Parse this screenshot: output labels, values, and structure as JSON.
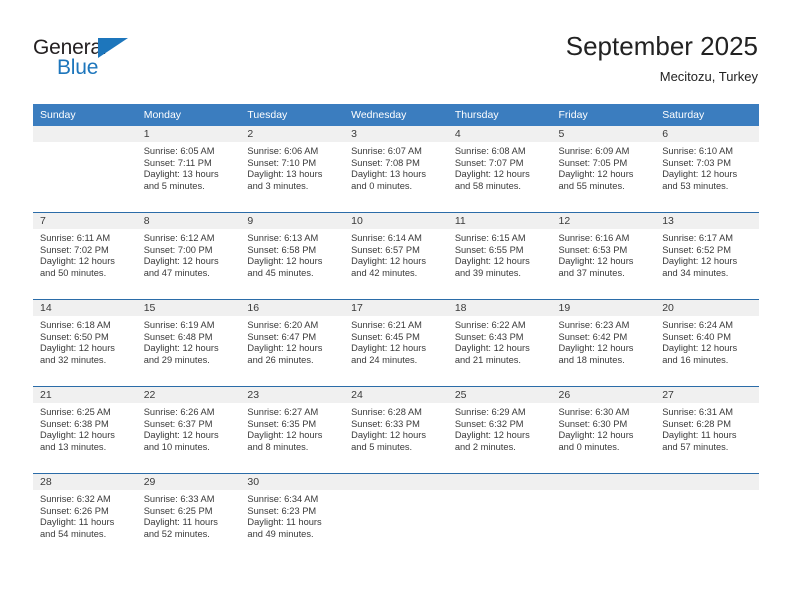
{
  "brand": {
    "name_top": "General",
    "name_bottom": "Blue",
    "color_dark": "#231f20",
    "color_blue": "#1d76bc"
  },
  "header": {
    "title": "September 2025",
    "subtitle": "Mecitozu, Turkey"
  },
  "theme": {
    "header_blue": "#3b7dbf",
    "separator_blue": "#2b6ca8",
    "daynum_band": "#f0f0f0",
    "text": "#3a3a3a"
  },
  "weekdays": [
    "Sunday",
    "Monday",
    "Tuesday",
    "Wednesday",
    "Thursday",
    "Friday",
    "Saturday"
  ],
  "weeks": [
    [
      {
        "day": "",
        "sunrise": "",
        "sunset": "",
        "daylight1": "",
        "daylight2": ""
      },
      {
        "day": "1",
        "sunrise": "Sunrise: 6:05 AM",
        "sunset": "Sunset: 7:11 PM",
        "daylight1": "Daylight: 13 hours",
        "daylight2": "and 5 minutes."
      },
      {
        "day": "2",
        "sunrise": "Sunrise: 6:06 AM",
        "sunset": "Sunset: 7:10 PM",
        "daylight1": "Daylight: 13 hours",
        "daylight2": "and 3 minutes."
      },
      {
        "day": "3",
        "sunrise": "Sunrise: 6:07 AM",
        "sunset": "Sunset: 7:08 PM",
        "daylight1": "Daylight: 13 hours",
        "daylight2": "and 0 minutes."
      },
      {
        "day": "4",
        "sunrise": "Sunrise: 6:08 AM",
        "sunset": "Sunset: 7:07 PM",
        "daylight1": "Daylight: 12 hours",
        "daylight2": "and 58 minutes."
      },
      {
        "day": "5",
        "sunrise": "Sunrise: 6:09 AM",
        "sunset": "Sunset: 7:05 PM",
        "daylight1": "Daylight: 12 hours",
        "daylight2": "and 55 minutes."
      },
      {
        "day": "6",
        "sunrise": "Sunrise: 6:10 AM",
        "sunset": "Sunset: 7:03 PM",
        "daylight1": "Daylight: 12 hours",
        "daylight2": "and 53 minutes."
      }
    ],
    [
      {
        "day": "7",
        "sunrise": "Sunrise: 6:11 AM",
        "sunset": "Sunset: 7:02 PM",
        "daylight1": "Daylight: 12 hours",
        "daylight2": "and 50 minutes."
      },
      {
        "day": "8",
        "sunrise": "Sunrise: 6:12 AM",
        "sunset": "Sunset: 7:00 PM",
        "daylight1": "Daylight: 12 hours",
        "daylight2": "and 47 minutes."
      },
      {
        "day": "9",
        "sunrise": "Sunrise: 6:13 AM",
        "sunset": "Sunset: 6:58 PM",
        "daylight1": "Daylight: 12 hours",
        "daylight2": "and 45 minutes."
      },
      {
        "day": "10",
        "sunrise": "Sunrise: 6:14 AM",
        "sunset": "Sunset: 6:57 PM",
        "daylight1": "Daylight: 12 hours",
        "daylight2": "and 42 minutes."
      },
      {
        "day": "11",
        "sunrise": "Sunrise: 6:15 AM",
        "sunset": "Sunset: 6:55 PM",
        "daylight1": "Daylight: 12 hours",
        "daylight2": "and 39 minutes."
      },
      {
        "day": "12",
        "sunrise": "Sunrise: 6:16 AM",
        "sunset": "Sunset: 6:53 PM",
        "daylight1": "Daylight: 12 hours",
        "daylight2": "and 37 minutes."
      },
      {
        "day": "13",
        "sunrise": "Sunrise: 6:17 AM",
        "sunset": "Sunset: 6:52 PM",
        "daylight1": "Daylight: 12 hours",
        "daylight2": "and 34 minutes."
      }
    ],
    [
      {
        "day": "14",
        "sunrise": "Sunrise: 6:18 AM",
        "sunset": "Sunset: 6:50 PM",
        "daylight1": "Daylight: 12 hours",
        "daylight2": "and 32 minutes."
      },
      {
        "day": "15",
        "sunrise": "Sunrise: 6:19 AM",
        "sunset": "Sunset: 6:48 PM",
        "daylight1": "Daylight: 12 hours",
        "daylight2": "and 29 minutes."
      },
      {
        "day": "16",
        "sunrise": "Sunrise: 6:20 AM",
        "sunset": "Sunset: 6:47 PM",
        "daylight1": "Daylight: 12 hours",
        "daylight2": "and 26 minutes."
      },
      {
        "day": "17",
        "sunrise": "Sunrise: 6:21 AM",
        "sunset": "Sunset: 6:45 PM",
        "daylight1": "Daylight: 12 hours",
        "daylight2": "and 24 minutes."
      },
      {
        "day": "18",
        "sunrise": "Sunrise: 6:22 AM",
        "sunset": "Sunset: 6:43 PM",
        "daylight1": "Daylight: 12 hours",
        "daylight2": "and 21 minutes."
      },
      {
        "day": "19",
        "sunrise": "Sunrise: 6:23 AM",
        "sunset": "Sunset: 6:42 PM",
        "daylight1": "Daylight: 12 hours",
        "daylight2": "and 18 minutes."
      },
      {
        "day": "20",
        "sunrise": "Sunrise: 6:24 AM",
        "sunset": "Sunset: 6:40 PM",
        "daylight1": "Daylight: 12 hours",
        "daylight2": "and 16 minutes."
      }
    ],
    [
      {
        "day": "21",
        "sunrise": "Sunrise: 6:25 AM",
        "sunset": "Sunset: 6:38 PM",
        "daylight1": "Daylight: 12 hours",
        "daylight2": "and 13 minutes."
      },
      {
        "day": "22",
        "sunrise": "Sunrise: 6:26 AM",
        "sunset": "Sunset: 6:37 PM",
        "daylight1": "Daylight: 12 hours",
        "daylight2": "and 10 minutes."
      },
      {
        "day": "23",
        "sunrise": "Sunrise: 6:27 AM",
        "sunset": "Sunset: 6:35 PM",
        "daylight1": "Daylight: 12 hours",
        "daylight2": "and 8 minutes."
      },
      {
        "day": "24",
        "sunrise": "Sunrise: 6:28 AM",
        "sunset": "Sunset: 6:33 PM",
        "daylight1": "Daylight: 12 hours",
        "daylight2": "and 5 minutes."
      },
      {
        "day": "25",
        "sunrise": "Sunrise: 6:29 AM",
        "sunset": "Sunset: 6:32 PM",
        "daylight1": "Daylight: 12 hours",
        "daylight2": "and 2 minutes."
      },
      {
        "day": "26",
        "sunrise": "Sunrise: 6:30 AM",
        "sunset": "Sunset: 6:30 PM",
        "daylight1": "Daylight: 12 hours",
        "daylight2": "and 0 minutes."
      },
      {
        "day": "27",
        "sunrise": "Sunrise: 6:31 AM",
        "sunset": "Sunset: 6:28 PM",
        "daylight1": "Daylight: 11 hours",
        "daylight2": "and 57 minutes."
      }
    ],
    [
      {
        "day": "28",
        "sunrise": "Sunrise: 6:32 AM",
        "sunset": "Sunset: 6:26 PM",
        "daylight1": "Daylight: 11 hours",
        "daylight2": "and 54 minutes."
      },
      {
        "day": "29",
        "sunrise": "Sunrise: 6:33 AM",
        "sunset": "Sunset: 6:25 PM",
        "daylight1": "Daylight: 11 hours",
        "daylight2": "and 52 minutes."
      },
      {
        "day": "30",
        "sunrise": "Sunrise: 6:34 AM",
        "sunset": "Sunset: 6:23 PM",
        "daylight1": "Daylight: 11 hours",
        "daylight2": "and 49 minutes."
      },
      {
        "day": "",
        "sunrise": "",
        "sunset": "",
        "daylight1": "",
        "daylight2": ""
      },
      {
        "day": "",
        "sunrise": "",
        "sunset": "",
        "daylight1": "",
        "daylight2": ""
      },
      {
        "day": "",
        "sunrise": "",
        "sunset": "",
        "daylight1": "",
        "daylight2": ""
      },
      {
        "day": "",
        "sunrise": "",
        "sunset": "",
        "daylight1": "",
        "daylight2": ""
      }
    ]
  ]
}
